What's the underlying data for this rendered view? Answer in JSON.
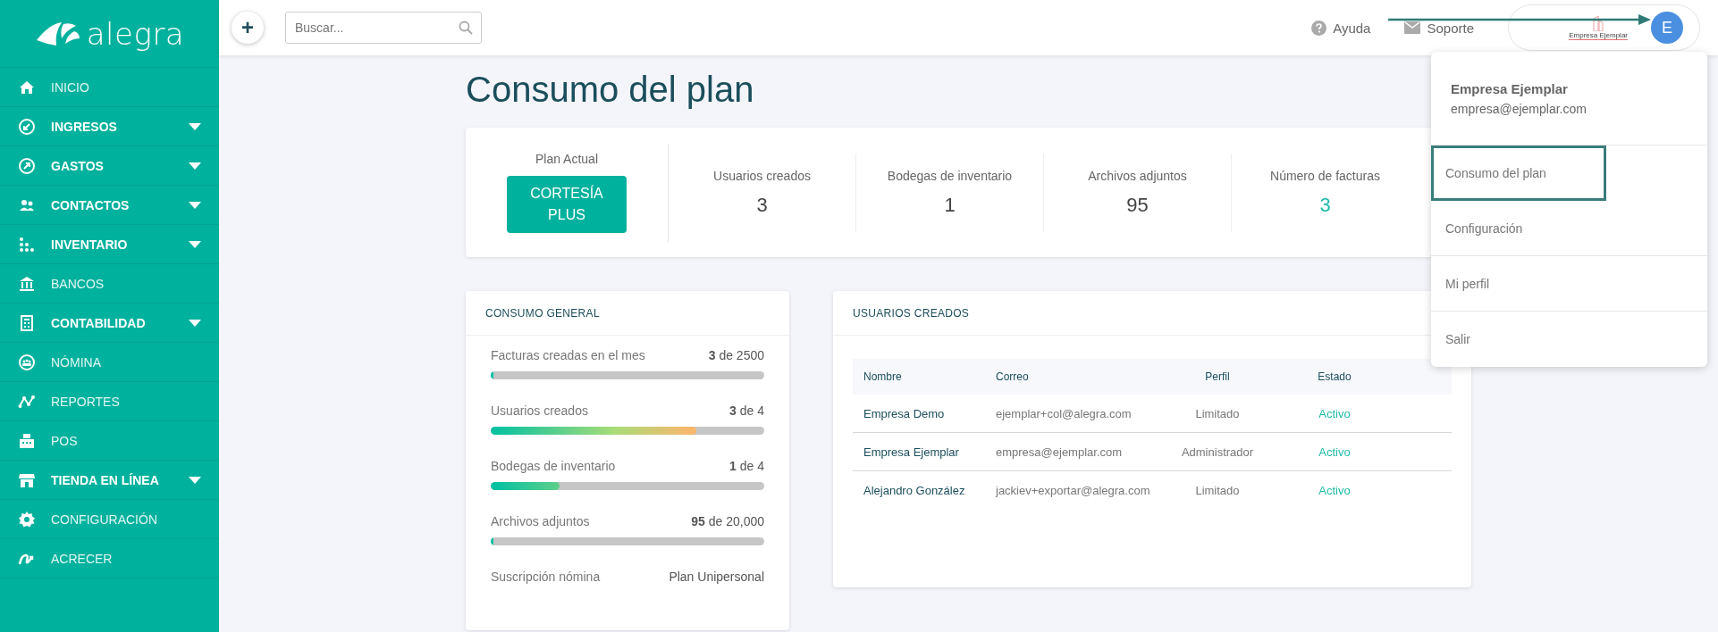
{
  "sidebar": {
    "logo": "alegra",
    "items": [
      {
        "label": "INICIO",
        "expandable": false
      },
      {
        "label": "INGRESOS",
        "expandable": true
      },
      {
        "label": "GASTOS",
        "expandable": true
      },
      {
        "label": "CONTACTOS",
        "expandable": true
      },
      {
        "label": "INVENTARIO",
        "expandable": true
      },
      {
        "label": "BANCOS",
        "expandable": false
      },
      {
        "label": "CONTABILIDAD",
        "expandable": true
      },
      {
        "label": "NÓMINA",
        "expandable": false
      },
      {
        "label": "REPORTES",
        "expandable": false
      },
      {
        "label": "POS",
        "expandable": false
      },
      {
        "label": "TIENDA EN LÍNEA",
        "expandable": true
      },
      {
        "label": "CONFIGURACIÓN",
        "expandable": false
      },
      {
        "label": "ACRECER",
        "expandable": false
      }
    ]
  },
  "topbar": {
    "add_button": "+",
    "search": {
      "placeholder": "Buscar..."
    },
    "links": [
      "Ayuda",
      "Soporte"
    ],
    "account": {
      "company_logo_text": "Empresa Ejemplar",
      "avatar": "E"
    }
  },
  "page": {
    "title": "Consumo del plan"
  },
  "plan": {
    "label": "Plan Actual",
    "button": "CORTESÍA PLUS"
  },
  "stats": [
    {
      "label": "Usuarios creados",
      "value": "3",
      "highlight": false
    },
    {
      "label": "Bodegas de inventario",
      "value": "1",
      "highlight": false
    },
    {
      "label": "Archivos adjuntos",
      "value": "95",
      "highlight": false
    },
    {
      "label": "Número de facturas",
      "value": "3",
      "highlight": true
    }
  ],
  "consumo": {
    "title": "CONSUMO GENERAL",
    "meters": [
      {
        "label": "Facturas creadas en el mes",
        "reading": "**3** de 2500",
        "level": 0.01
      },
      {
        "label": "Usuarios creados",
        "reading": "**3** de 4",
        "level": 0.75
      },
      {
        "label": "Bodegas de inventario",
        "reading": "**1** de 4",
        "level": 0.25
      },
      {
        "label": "Archivos adjuntos",
        "reading": "**95** de 20,000",
        "level": 0.01
      }
    ],
    "subscription": {
      "label": "Suscripción nómina",
      "value": "Plan Unipersonal"
    }
  },
  "users": {
    "title": "USUARIOS CREADOS",
    "columns": [
      "Nombre",
      "Correo",
      "Perfil",
      "Estado"
    ],
    "rows": [
      {
        "cells": [
          "Empresa Demo",
          "ejemplar+col@alegra.com",
          "Limitado",
          "Activo"
        ]
      },
      {
        "cells": [
          "Empresa Ejemplar",
          "empresa@ejemplar.com",
          "Administrador",
          "Activo"
        ]
      },
      {
        "cells": [
          "Alejandro González",
          "jackiev+exportar@alegra.com",
          "Limitado",
          "Activo"
        ]
      }
    ]
  },
  "menu": {
    "name": "Empresa Ejemplar",
    "email": "empresa@ejemplar.com",
    "items": [
      {
        "label": "Consumo del plan",
        "selected": true
      },
      {
        "label": "Configuración",
        "selected": false
      },
      {
        "label": "Mi perfil",
        "selected": false
      },
      {
        "label": "Salir",
        "selected": false
      }
    ]
  }
}
